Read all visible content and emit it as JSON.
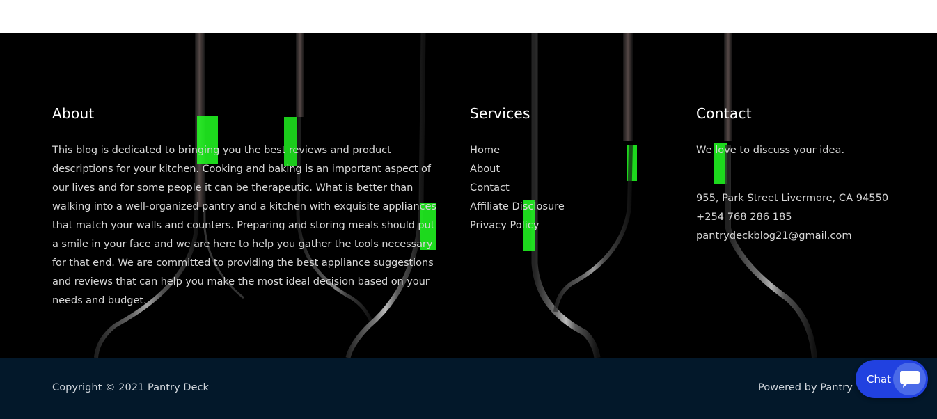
{
  "about": {
    "heading": "About",
    "text": "This blog is dedicated to bringing you the best reviews and product descriptions for your kitchen. Cooking and baking is an important aspect of our lives and for some people it can be therapeutic. What is better than walking into a well-organized pantry and a kitchen with exquisite appliances that match your walls and counters. Preparing and storing meals should put a smile in your face and we are here to help you gather the tools necessary for that end. We are committed to providing the best appliance suggestions and reviews that can help you make the most ideal decision based on your needs and budget."
  },
  "services": {
    "heading": "Services",
    "links": [
      "Home",
      "About",
      "Contact",
      "Affiliate Disclosure",
      "Privacy Policy"
    ]
  },
  "contact": {
    "heading": "Contact",
    "intro": "We love to discuss your idea.",
    "address": "955, Park Street Livermore, CA 94550",
    "phone": "+254 768 286 185",
    "email": "pantrydeckblog21@gmail.com"
  },
  "bottom": {
    "copyright": "Copyright © 2021 Pantry Deck",
    "powered": "Powered by Pantry"
  },
  "chat": {
    "label": "Chat",
    "icon": "chat-bubble-icon"
  },
  "colors": {
    "footer_bg": "#000000",
    "bottom_bar": "#03182a",
    "chat_accent": "#2141e0",
    "bottle_neck_glow": "#22ff22"
  }
}
